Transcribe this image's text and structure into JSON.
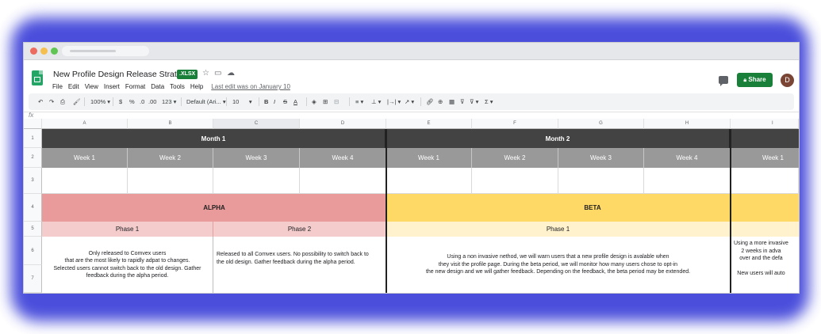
{
  "doc": {
    "title": "New Profile Design Release Strategy",
    "badge": ".XLSX",
    "menu": [
      "File",
      "Edit",
      "View",
      "Insert",
      "Format",
      "Data",
      "Tools",
      "Help"
    ],
    "last_edit": "Last edit was on January 10",
    "share_label": "Share",
    "avatar_initial": "D"
  },
  "toolbar": {
    "zoom": "100%",
    "currency": "$",
    "percent": "%",
    "dec_decrease": ".0",
    "dec_increase": ".00",
    "number_format": "123",
    "font_family": "Default (Ari...",
    "font_size": "10",
    "bold": "B",
    "italic": "I",
    "strike": "S",
    "text_color": "A",
    "functions": "Σ"
  },
  "formula_bar": {
    "fx": "fx"
  },
  "grid": {
    "columns": [
      "A",
      "B",
      "C",
      "D",
      "E",
      "F",
      "G",
      "H",
      "I"
    ],
    "rows": [
      "1",
      "2",
      "3",
      "4",
      "5",
      "6",
      "7"
    ],
    "month1": "Month 1",
    "month2": "Month 2",
    "weeks": [
      "Week 1",
      "Week 2",
      "Week 3",
      "Week 4",
      "Week 1",
      "Week 2",
      "Week 3",
      "Week 4",
      "Week 1"
    ],
    "alpha": "ALPHA",
    "beta": "BETA",
    "alpha_phase1": "Phase 1",
    "alpha_phase2": "Phase 2",
    "beta_phase1": "Phase 1",
    "alpha_phase1_desc": "Only released to Comvex users\nthat are the most likely to rapidly adpat to changes.\nSelected users cannot switch back to the old design. Gather\nfeedback during the alpha period.",
    "alpha_phase2_desc": "Released to all Comvex users. No possibility to switch back to\nthe old design. Gather feedback during the alpha period.",
    "beta_phase1_desc": "Using a non invasive nethod, we will warn users that a new profile design is avalable when\nthey visit the profile page. During the beta period, we will monitor how many users chose to opt-in\nthe new design and we will gather feedback. Depending on the feedback, the beta period may be extended.",
    "partial_desc": "Using a more invasive\n2 weeks in adva\nover and the defa\n\nNew users will auto"
  },
  "colors": {
    "month_header": "#434343",
    "week_header": "#999999",
    "alpha": "#e99a9a",
    "alpha_phase": "#f4cccc",
    "beta": "#ffd966",
    "beta_phase": "#fff2cc",
    "share_button": "#188038",
    "backdrop_glow": "#3b3fd8"
  }
}
